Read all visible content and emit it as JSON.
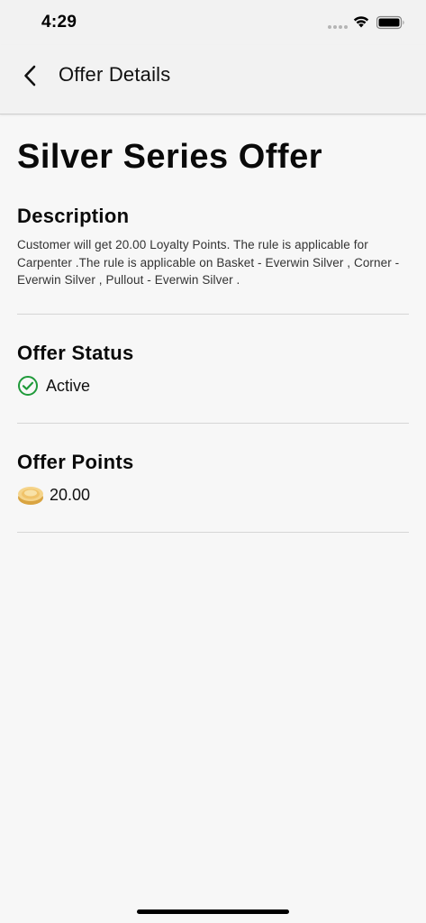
{
  "status_bar": {
    "time": "4:29"
  },
  "nav": {
    "title": "Offer Details"
  },
  "offer": {
    "title": "Silver Series Offer",
    "description_heading": "Description",
    "description": "Customer will get 20.00 Loyalty Points. The rule is applicable for Carpenter .The rule is applicable on Basket - Everwin Silver , Corner - Everwin Silver , Pullout - Everwin Silver .",
    "status_heading": "Offer Status",
    "status_value": "Active",
    "points_heading": "Offer Points",
    "points_value": "20.00"
  },
  "colors": {
    "active_green": "#1f9a3a",
    "coin_gold": "#f0c36a"
  },
  "icons": {
    "back": "chevron-left-icon",
    "status": "check-circle-icon",
    "points": "coin-icon"
  }
}
